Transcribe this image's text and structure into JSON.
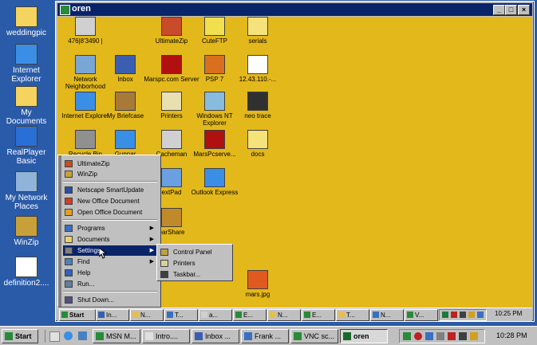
{
  "outer_desktop": {
    "icons": [
      {
        "label": "weddingpic",
        "icon": "folder-icon",
        "color": "#f4d35e"
      },
      {
        "label": "Internet Explorer",
        "icon": "internet-explorer-icon",
        "color": "#3a8ee6"
      },
      {
        "label": "My Documents",
        "icon": "my-documents-icon",
        "color": "#f4d35e"
      },
      {
        "label": "RealPlayer Basic",
        "icon": "realplayer-icon",
        "color": "#2a6fd6"
      },
      {
        "label": "My Network Places",
        "icon": "network-places-icon",
        "color": "#8fb3d9"
      },
      {
        "label": "WinZip",
        "icon": "winzip-icon",
        "color": "#c8a03a"
      },
      {
        "label": "definition2....",
        "icon": "document-icon",
        "color": "#ffffff"
      }
    ]
  },
  "remote_window": {
    "title": "oren",
    "buttons": [
      "_",
      "□",
      "×"
    ],
    "desktop_color": "#e3b81b",
    "icons": [
      {
        "label": "476|8'3490 |",
        "icon": "computer-icon",
        "color": "#d0d0d0"
      },
      {
        "label": "UltimateZip",
        "icon": "ultimatezip-icon",
        "color": "#c84b2a"
      },
      {
        "label": "CuteFTP",
        "icon": "cuteftp-icon",
        "color": "#f0e050"
      },
      {
        "label": "serials",
        "icon": "folder-icon",
        "color": "#f6e27a"
      },
      {
        "label": "Network Neighborhood",
        "icon": "network-icon",
        "color": "#7aa6d6"
      },
      {
        "label": "Inbox",
        "icon": "inbox-icon",
        "color": "#3a5fb0"
      },
      {
        "label": "Marspc.com Server",
        "icon": "mars-server-icon",
        "color": "#b01010"
      },
      {
        "label": "PSP 7",
        "icon": "psp-icon",
        "color": "#d87020"
      },
      {
        "label": "12.43.110.-...",
        "icon": "document-icon",
        "color": "#ffffff"
      },
      {
        "label": "Internet Explorer",
        "icon": "internet-explorer-icon",
        "color": "#3a8ee6"
      },
      {
        "label": "My Briefcase",
        "icon": "briefcase-icon",
        "color": "#a87a3a"
      },
      {
        "label": "Printers",
        "icon": "printers-icon",
        "color": "#e8e0b0"
      },
      {
        "label": "Windows NT Explorer",
        "icon": "nt-explorer-icon",
        "color": "#88bbdd"
      },
      {
        "label": "neo trace",
        "icon": "neotrace-icon",
        "color": "#303030"
      },
      {
        "label": "Recycle Bin",
        "icon": "recycle-bin-icon",
        "color": "#909090"
      },
      {
        "label": "Gunnar",
        "icon": "internet-explorer-icon",
        "color": "#3a8ee6"
      },
      {
        "label": "Cacheman",
        "icon": "cacheman-icon",
        "color": "#d0d0d0"
      },
      {
        "label": "MarsPcserve...",
        "icon": "mars-server-icon",
        "color": "#b01010"
      },
      {
        "label": "docs",
        "icon": "folder-icon",
        "color": "#f6e27a"
      },
      {
        "label": "extPad",
        "icon": "textpad-icon",
        "color": "#6aa0e0"
      },
      {
        "label": "Outlook Express",
        "icon": "outlook-express-icon",
        "color": "#3a8ee6"
      },
      {
        "label": "earShare",
        "icon": "bearshare-icon",
        "color": "#c08a2a"
      },
      {
        "label": "mars.jpg",
        "icon": "image-file-icon",
        "color": "#e05a20"
      }
    ]
  },
  "start_menu": {
    "items": [
      {
        "label": "UltimateZip",
        "icon": "ultimatezip-icon",
        "color": "#c84b2a"
      },
      {
        "label": "WinZip",
        "icon": "winzip-icon",
        "color": "#c8a03a"
      },
      {
        "label": "Netscape SmartUpdate",
        "icon": "netscape-icon",
        "color": "#2a4fa0"
      },
      {
        "label": "New Office Document",
        "icon": "office-icon",
        "color": "#d04020"
      },
      {
        "label": "Open Office Document",
        "icon": "office-icon",
        "color": "#e0a020"
      },
      {
        "label": "Programs",
        "icon": "programs-icon",
        "color": "#3a70c0",
        "arrow": "▶"
      },
      {
        "label": "Documents",
        "icon": "documents-icon",
        "color": "#e8d070",
        "arrow": "▶"
      },
      {
        "label": "Settings",
        "icon": "settings-icon",
        "color": "#808080",
        "arrow": "▶"
      },
      {
        "label": "Find",
        "icon": "find-icon",
        "color": "#4a80c0",
        "arrow": "▶"
      },
      {
        "label": "Help",
        "icon": "help-icon",
        "color": "#3060c0"
      },
      {
        "label": "Run...",
        "icon": "run-icon",
        "color": "#6080a0"
      },
      {
        "label": "Shut Down...",
        "icon": "shutdown-icon",
        "color": "#505080"
      }
    ],
    "selected_index": 7
  },
  "settings_submenu": {
    "items": [
      {
        "label": "Control Panel",
        "icon": "control-panel-icon",
        "color": "#c0a040"
      },
      {
        "label": "Printers",
        "icon": "printers-icon",
        "color": "#d8d0a0"
      },
      {
        "label": "Taskbar...",
        "icon": "taskbar-icon",
        "color": "#404040"
      }
    ]
  },
  "remote_taskbar": {
    "start_label": "Start",
    "buttons": [
      "In...",
      "N...",
      "T...",
      "a...",
      "E...",
      "N...",
      "E...",
      "T...",
      "N...",
      "V..."
    ],
    "time": "10:25 PM"
  },
  "outer_taskbar": {
    "start_label": "Start",
    "buttons": [
      "MSN M...",
      "Intro....",
      "Inbox ...",
      "Frank ...",
      "VNC sc...",
      "oren"
    ],
    "active_button": "oren",
    "time": "10:28 PM"
  }
}
